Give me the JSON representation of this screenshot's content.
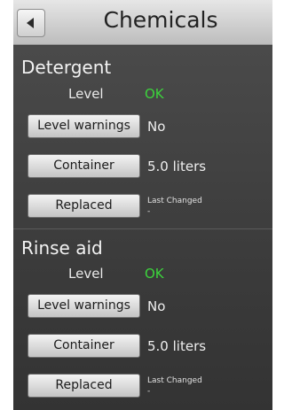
{
  "header": {
    "title": "Chemicals",
    "back_icon": "back-arrow-icon"
  },
  "detergent": {
    "title": "Detergent",
    "level_label": "Level",
    "level_value": "OK",
    "level_warnings_button": "Level warnings",
    "level_warnings_value": "No",
    "container_button": "Container",
    "container_value": "5.0 liters",
    "replaced_button": "Replaced",
    "last_changed_label": "Last Changed",
    "last_changed_value": "-"
  },
  "rinse_aid": {
    "title": "Rinse aid",
    "level_label": "Level",
    "level_value": "OK",
    "level_warnings_button": "Level warnings",
    "level_warnings_value": "No",
    "container_button": "Container",
    "container_value": "5.0 liters",
    "replaced_button": "Replaced",
    "last_changed_label": "Last Changed",
    "last_changed_value": "-"
  },
  "colors": {
    "ok": "#3cd43c",
    "panel": "#3a3a3a",
    "header": "#d0d0d0"
  }
}
